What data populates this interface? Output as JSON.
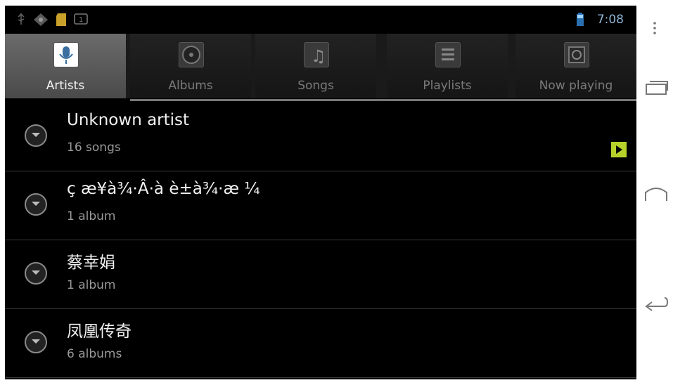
{
  "status_bar": {
    "time": "7:08",
    "icons": [
      "usb-icon",
      "debug-icon",
      "sd-card-icon",
      "notification-icon",
      "battery-icon"
    ]
  },
  "tabs": [
    {
      "label": "Artists",
      "icon": "microphone-icon",
      "selected": true
    },
    {
      "label": "Albums",
      "icon": "disc-icon",
      "selected": false
    },
    {
      "label": "Songs",
      "icon": "music-note-icon",
      "selected": false
    },
    {
      "label": "Playlists",
      "icon": "playlist-icon",
      "selected": false
    },
    {
      "label": "Now playing",
      "icon": "now-playing-icon",
      "selected": false
    }
  ],
  "artists": [
    {
      "name": "Unknown artist",
      "count": "16 songs",
      "now_playing": true
    },
    {
      "name": "ç æ¥à¾·Â·à è±à¾·æ ¼",
      "count": "1 album",
      "now_playing": false
    },
    {
      "name": "蔡幸娟",
      "count": "1 album",
      "now_playing": false
    },
    {
      "name": "凤凰传奇",
      "count": "6 albums",
      "now_playing": false
    }
  ],
  "nav": [
    "menu-icon",
    "recent-apps-icon",
    "home-icon",
    "back-icon"
  ],
  "colors": {
    "accent_playing": "#b6d22a",
    "clock": "#8fb5d6",
    "selected_tab": "#5a5a5a"
  }
}
